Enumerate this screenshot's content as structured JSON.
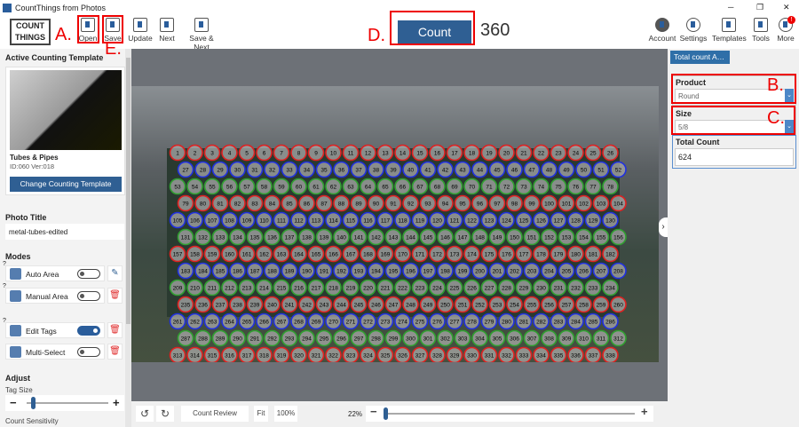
{
  "window": {
    "title": "CountThings from Photos",
    "minimize": "─",
    "restore": "❐",
    "close": "✕"
  },
  "toolbar": {
    "logo": "COUNT THINGS",
    "open": "Open",
    "save": "Save",
    "update": "Update",
    "next": "Next",
    "save_next": "Save & Next",
    "count_button": "Count",
    "count_value": "360",
    "account": "Account",
    "settings": "Settings",
    "templates": "Templates",
    "tools": "Tools",
    "more": "More",
    "more_badge": "!"
  },
  "annotations": {
    "a": "A.",
    "b": "B.",
    "c": "C.",
    "d": "D.",
    "e": "E.",
    "color": "#e00000"
  },
  "left": {
    "active_template_heading": "Active Counting Template",
    "template_name": "Tubes & Pipes",
    "template_id": "ID:060 Ver:018",
    "change_template": "Change Counting Template",
    "photo_title_heading": "Photo Title",
    "photo_title_value": "metal-tubes-edited",
    "modes_heading": "Modes",
    "modes": [
      {
        "label": "Auto Area",
        "on": false,
        "side": "edit"
      },
      {
        "label": "Manual Area",
        "on": false,
        "side": "delete"
      },
      {
        "label": "Edit Tags",
        "on": true,
        "side": "delete"
      },
      {
        "label": "Multi-Select",
        "on": false,
        "side": "delete"
      }
    ],
    "help": "?",
    "adjust_heading": "Adjust",
    "tag_size_label": "Tag Size",
    "tag_size_level": 0.05,
    "count_sensitivity_label": "Count Sensitivity",
    "minus": "−",
    "plus": "+"
  },
  "bottom": {
    "count_review": "Count Review",
    "fit": "Fit",
    "zoom_100": "100%",
    "zoom_level": "22%",
    "minus": "−",
    "plus": "+"
  },
  "right": {
    "tab": "Total count A…",
    "product_label": "Product",
    "product_value": "Round",
    "size_label": "Size",
    "size_value": "5/8",
    "total_label": "Total Count",
    "total_value": "624"
  },
  "colors": {
    "accent": "#2a5d9b",
    "tag_red": "#e02020",
    "tag_blue": "#2030e0",
    "tag_green": "#30a030"
  }
}
